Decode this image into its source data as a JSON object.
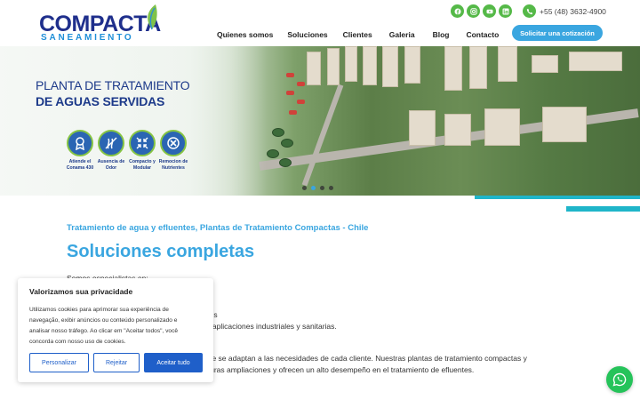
{
  "header": {
    "logo": {
      "main": "COMPACTA",
      "sub": "SANEAMIENTO"
    },
    "social": [
      {
        "name": "facebook-icon"
      },
      {
        "name": "instagram-icon"
      },
      {
        "name": "youtube-icon"
      },
      {
        "name": "linkedin-icon"
      }
    ],
    "phone": "+55 (48) 3632-4900",
    "nav": [
      "Quienes somos",
      "Soluciones",
      "Clientes",
      "Galeria",
      "Blog",
      "Contacto"
    ],
    "cta": "Solicitar una cotización"
  },
  "hero": {
    "title_line1": "PLANTA DE TRATAMIENTO",
    "title_line2": "DE AGUAS SERVIDAS",
    "badges": [
      {
        "icon": "award-icon",
        "label": "Atiende el Conama 430"
      },
      {
        "icon": "no-odor-icon",
        "label": "Ausencia de Odor"
      },
      {
        "icon": "compact-icon",
        "label": "Compacto y Modular"
      },
      {
        "icon": "remove-icon",
        "label": "Remocion de Nutrientes"
      }
    ],
    "slides": 4,
    "active_slide": 2
  },
  "content": {
    "subheading": "Tratamiento de agua y efluentes, Plantas de Tratamiento Compactas - Chile",
    "heading": "Soluciones completas",
    "intro": "Somos especialistas en:",
    "line1": "ales",
    "line2": "ra aplicaciones industriales y sanitarias.",
    "para_line1": "que se adaptan a las necesidades de cada cliente. Nuestras plantas de tratamiento compactas y",
    "para_line2": "uturas ampliaciones y ofrecen un alto desempeño en el tratamiento de efluentes."
  },
  "cookie": {
    "title": "Valorizamos sua privacidade",
    "body": "Utilizamos cookies para aprimorar sua experiência de navegação, exibir anúncios ou conteúdo personalizado e analisar nosso tráfego. Ao clicar em \"Aceitar todos\", você concorda com nosso uso de cookies.",
    "buttons": {
      "customize": "Personalizar",
      "reject": "Rejeitar",
      "accept": "Aceitar tudo"
    }
  },
  "colors": {
    "brand_blue": "#1f2f8c",
    "accent": "#3aa6e0",
    "green": "#55b948",
    "cookie_blue": "#1f5fc9",
    "whatsapp": "#25c35a"
  }
}
